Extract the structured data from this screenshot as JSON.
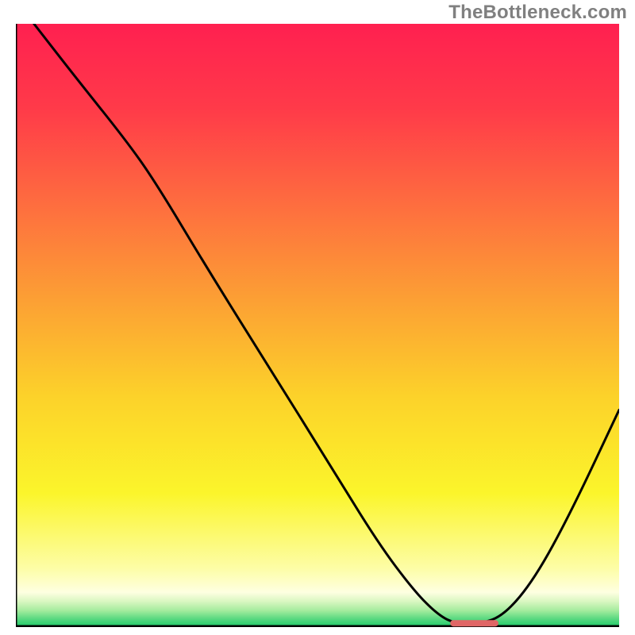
{
  "watermark": "TheBottleneck.com",
  "colors": {
    "watermark": "#808080",
    "gradient_stops": [
      {
        "offset": 0,
        "color": "#ff2050"
      },
      {
        "offset": 0.14,
        "color": "#ff3a49"
      },
      {
        "offset": 0.3,
        "color": "#fe6d3f"
      },
      {
        "offset": 0.46,
        "color": "#fca034"
      },
      {
        "offset": 0.62,
        "color": "#fcd22a"
      },
      {
        "offset": 0.78,
        "color": "#fbf52b"
      },
      {
        "offset": 0.905,
        "color": "#fdfda6"
      },
      {
        "offset": 0.945,
        "color": "#feffe1"
      },
      {
        "offset": 0.96,
        "color": "#d9f7c1"
      },
      {
        "offset": 0.975,
        "color": "#a5ec9e"
      },
      {
        "offset": 0.987,
        "color": "#63db84"
      },
      {
        "offset": 1.0,
        "color": "#26cc6c"
      }
    ],
    "curve": "#000000",
    "marker": "#e06666",
    "axis": "#000000"
  },
  "chart_data": {
    "type": "line",
    "title": "",
    "xlabel": "",
    "ylabel": "",
    "xlim": [
      0,
      100
    ],
    "ylim": [
      0,
      100
    ],
    "x": [
      3,
      10,
      18,
      23,
      32,
      42,
      52,
      60,
      66,
      70,
      73,
      77,
      81,
      86,
      92,
      100
    ],
    "values": [
      100,
      91,
      81,
      74,
      59,
      43,
      27,
      14,
      6,
      2,
      0.5,
      0.5,
      2,
      8,
      19,
      36
    ],
    "plateau_x": [
      70,
      78
    ],
    "marker_x": [
      72,
      80
    ],
    "marker_y": 0.5,
    "notes": "Curve drops from top-left, has a short flat plateau near x≈70–78 at y≈0 (marked in red), then rises toward the right edge. Axes are unlabeled; only a bottom baseline and left border are drawn."
  }
}
